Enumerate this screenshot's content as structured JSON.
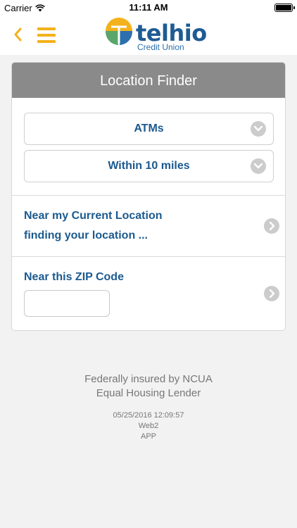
{
  "status_bar": {
    "carrier": "Carrier",
    "time": "11:11 AM"
  },
  "header": {
    "logo_name": "telhio",
    "logo_sub": "Credit Union"
  },
  "colors": {
    "accent": "#f3b21b",
    "brand_blue": "#1b5a8f",
    "header_gray": "#8a8a8a"
  },
  "card": {
    "title": "Location Finder",
    "type_select": {
      "value": "ATMs"
    },
    "distance_select": {
      "value": "Within 10 miles"
    },
    "current_location": {
      "title": "Near my Current Location",
      "status": "finding your location ..."
    },
    "zip": {
      "title": "Near this ZIP Code",
      "value": "",
      "placeholder": ""
    }
  },
  "footer": {
    "insured": "Federally insured by NCUA",
    "lender": "Equal Housing Lender",
    "timestamp": "05/25/2016 12:09:57",
    "server": "Web2",
    "channel": "APP"
  }
}
